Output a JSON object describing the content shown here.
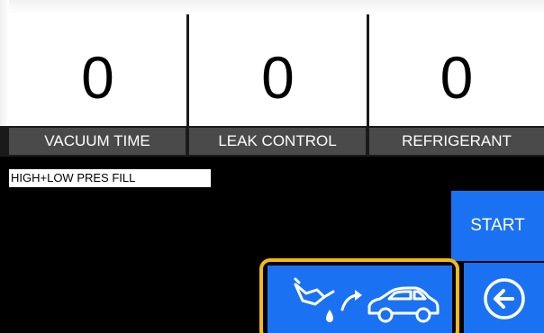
{
  "counters": [
    {
      "value": "0",
      "label": "VACUUM TIME"
    },
    {
      "value": "0",
      "label": "LEAK CONTROL"
    },
    {
      "value": "0",
      "label": "REFRIGERANT"
    }
  ],
  "mode_label": "HIGH+LOW PRES FILL",
  "buttons": {
    "start_label": "START",
    "fill_icon": "oil-can-to-car-icon",
    "back_icon": "arrow-left-circle-icon"
  },
  "colors": {
    "accent_blue": "#1a72f3",
    "highlight": "#f5b914",
    "label_bg": "#4a4a4a",
    "background": "#000000"
  }
}
